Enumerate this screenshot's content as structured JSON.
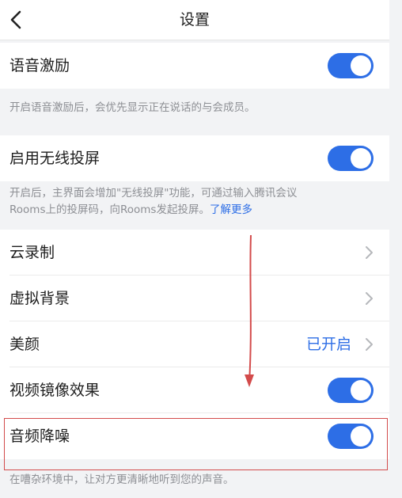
{
  "header": {
    "title": "设置"
  },
  "settings": {
    "voice_motivation": {
      "label": "语音激励",
      "enabled": true,
      "description": "开启语音激励后，会优先显示正在说话的与会成员。"
    },
    "wireless_projection": {
      "label": "启用无线投屏",
      "enabled": true,
      "description_line1": "开启后，主界面会增加\"无线投屏\"功能，可通过输入腾讯会议",
      "description_line2": "Rooms上的投屏码，向Rooms发起投屏。",
      "learn_more": "了解更多"
    },
    "cloud_recording": {
      "label": "云录制"
    },
    "virtual_background": {
      "label": "虚拟背景"
    },
    "beauty": {
      "label": "美颜",
      "value": "已开启"
    },
    "video_mirror": {
      "label": "视频镜像效果",
      "enabled": true
    },
    "noise_reduction": {
      "label": "音频降噪",
      "enabled": true,
      "description": "在嘈杂环境中，让对方更清晰地听到您的声音。"
    }
  },
  "colors": {
    "accent": "#2d6ee6",
    "annotation": "#d34b4b",
    "background": "#f2f3f5"
  }
}
